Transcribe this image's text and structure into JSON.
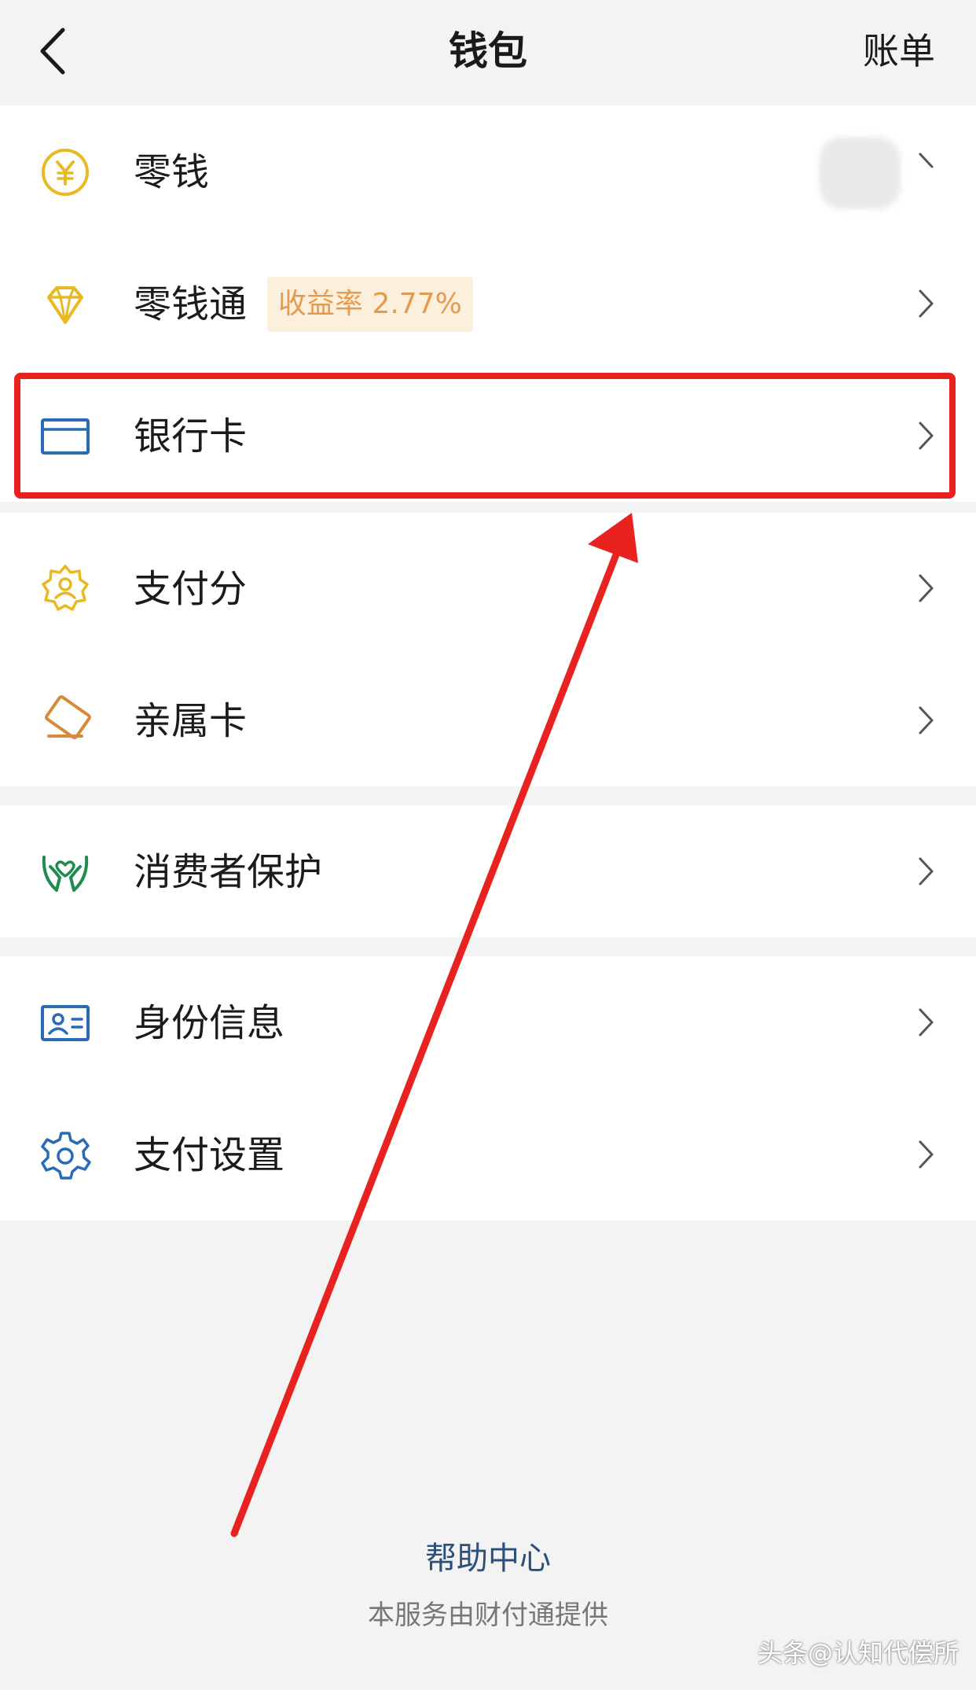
{
  "header": {
    "title": "钱包",
    "bill_label": "账单",
    "back_icon": "chevron-left-icon"
  },
  "group1": [
    {
      "label": "零钱",
      "icon": "yuan-coin-icon",
      "value": "¥"
    },
    {
      "label": "零钱通",
      "icon": "diamond-icon",
      "badge": "收益率 2.77%"
    },
    {
      "label": "银行卡",
      "icon": "bank-card-icon"
    },
    {
      "label": "支付分",
      "icon": "credit-score-icon"
    },
    {
      "label": "亲属卡",
      "icon": "family-card-icon"
    }
  ],
  "group2": [
    {
      "label": "消费者保护",
      "icon": "protection-hands-icon"
    }
  ],
  "group3": [
    {
      "label": "身份信息",
      "icon": "id-card-icon"
    },
    {
      "label": "支付设置",
      "icon": "gear-icon"
    }
  ],
  "footer": {
    "help": "帮助中心",
    "provider": "本服务由财付通提供"
  },
  "watermark": "头条@认知代偿所",
  "colors": {
    "highlight": "#e8231f",
    "gold": "#e8b923",
    "blue": "#2a6bb5",
    "green": "#1f8c4e",
    "orange": "#d9893a"
  }
}
